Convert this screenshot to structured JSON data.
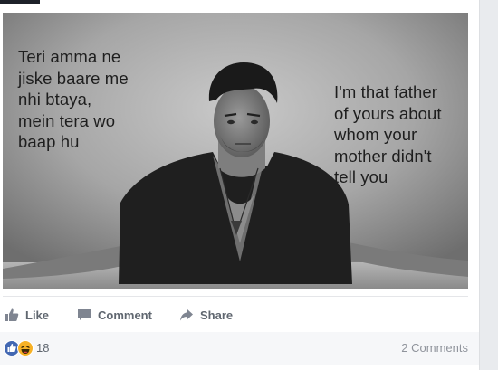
{
  "post": {
    "meme": {
      "caption_left": "Teri amma ne\njiske baare me\nnhi btaya,\nmein tera wo\nbaap hu",
      "caption_right": "I'm that father\nof yours about\nwhom your\nmother didn't\ntell you"
    },
    "actions": {
      "like_label": "Like",
      "comment_label": "Comment",
      "share_label": "Share"
    },
    "reactions": {
      "count": "18",
      "icons": [
        "like-icon",
        "haha-icon"
      ],
      "comments_label": "2 Comments"
    }
  },
  "colors": {
    "action_text": "#606770",
    "like_blue": "#4267b2",
    "haha_yellow": "#f7b125"
  }
}
